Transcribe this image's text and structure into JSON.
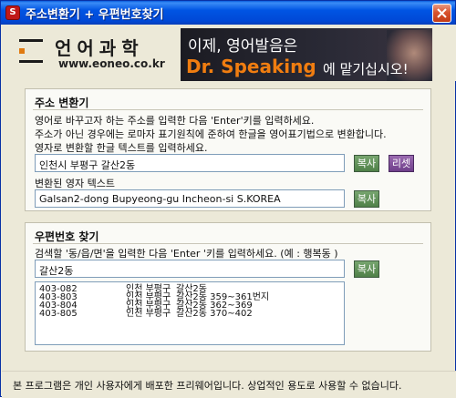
{
  "window": {
    "title": "주소변환기 + 우편번호찾기",
    "app_icon_glyph": "S"
  },
  "header": {
    "logo_text": "언어과학",
    "logo_url": "www.eoneo.co.kr",
    "banner_line1": "이제, 영어발음은",
    "banner_brand": "Dr. Speaking",
    "banner_suffix": "에 맡기십시오!"
  },
  "converter": {
    "title": "주소 변환기",
    "instruction1": "영어로 바꾸고자 하는 주소를 입력한 다음 'Enter'키를 입력하세요.",
    "instruction2": "주소가 아닌 경우에는 로마자 표기원칙에 준하여 한글을 영어표기법으로 변환합니다.",
    "input_label": "영자로 변환할 한글 텍스트를 입력하세요.",
    "input_value": "인천시 부평구 갈산2동",
    "copy_label": "복사",
    "reset_label": "리셋",
    "output_label": "변환된 영자 텍스트",
    "output_value": "Galsan2-dong Bupyeong-gu Incheon-si S.KOREA",
    "copy2_label": "복사"
  },
  "postcode": {
    "title": "우편번호 찾기",
    "instruction": "검색할 '동/읍/면'을 입력한 다음 'Enter '키를 입력하세요. (예 : 행복동 )",
    "search_value": "갈산2동",
    "copy_label": "복사",
    "results": [
      {
        "code": "403-082",
        "region": "인천 부평구",
        "detail": "갈산2동"
      },
      {
        "code": "403-803",
        "region": "인천 부평구",
        "detail": "갈산2동 359~361번지"
      },
      {
        "code": "403-804",
        "region": "인천 부평구",
        "detail": "갈산2동 362~369"
      },
      {
        "code": "403-805",
        "region": "인천 부평구",
        "detail": "갈산2동 370~402"
      }
    ]
  },
  "footer": {
    "notice": "본 프로그램은 개인 사용자에게 배포한 프리웨어입니다. 상업적인 용도로 사용할 수 없습니다."
  },
  "colors": {
    "titlebar": "#0054e3",
    "button_green": "#4f8148",
    "button_purple": "#6f3f8a",
    "banner_accent": "#f07d10"
  }
}
